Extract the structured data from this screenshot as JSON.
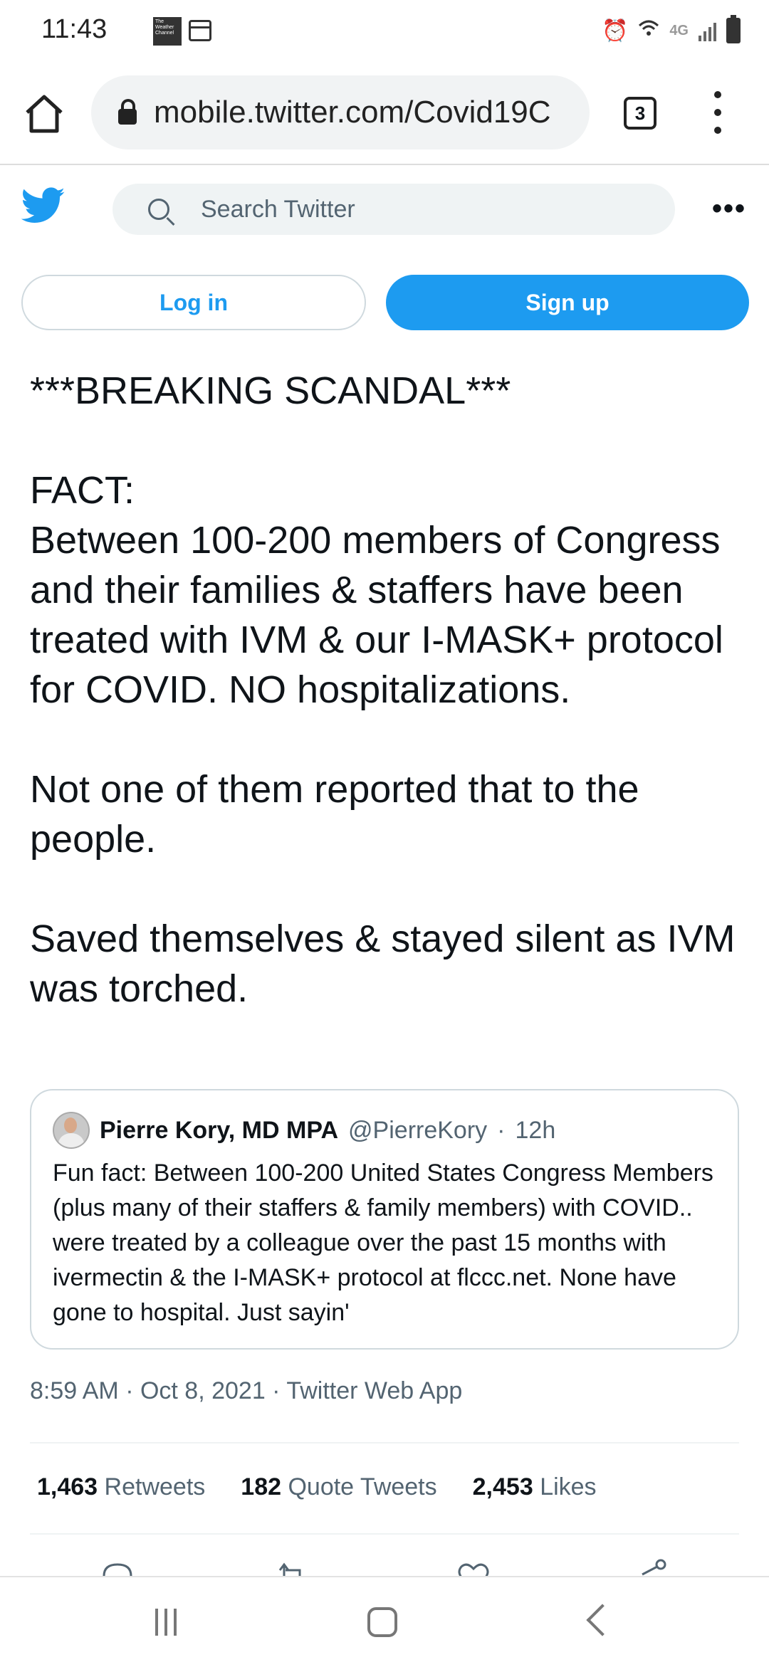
{
  "status_bar": {
    "time": "11:43",
    "weather_app_label": "The Weather Channel",
    "network": "4G"
  },
  "browser": {
    "url": "mobile.twitter.com/Covid19C",
    "tab_count": "3"
  },
  "twitter": {
    "search_placeholder": "Search Twitter",
    "more_label": "•••",
    "login_label": "Log in",
    "signup_label": "Sign up",
    "brand_color": "#1d9bf0"
  },
  "tweet": {
    "paragraphs": [
      "***BREAKING SCANDAL***",
      "FACT:\nBetween 100-200 members of Congress and their families & staffers have been treated with IVM & our I-MASK+ protocol for COVID. NO hospitalizations.",
      "Not one of them reported that to the people.",
      "Saved themselves & stayed silent as IVM was torched."
    ],
    "timestamp": "8:59 AM · Oct 8, 2021 · Twitter Web App"
  },
  "quoted_tweet": {
    "name": "Pierre Kory, MD MPA",
    "handle": "@PierreKory",
    "separator": "·",
    "time": "12h",
    "text": "Fun fact: Between 100-200 United States Congress Members (plus many of their staffers & family members) with COVID.. were treated by a colleague over the past 15 months with ivermectin & the I-MASK+ protocol at flccc.net. None have gone to hospital. Just sayin'"
  },
  "stats": {
    "retweets_count": "1,463",
    "retweets_label": "Retweets",
    "quotes_count": "182",
    "quotes_label": "Quote Tweets",
    "likes_count": "2,453",
    "likes_label": "Likes"
  }
}
